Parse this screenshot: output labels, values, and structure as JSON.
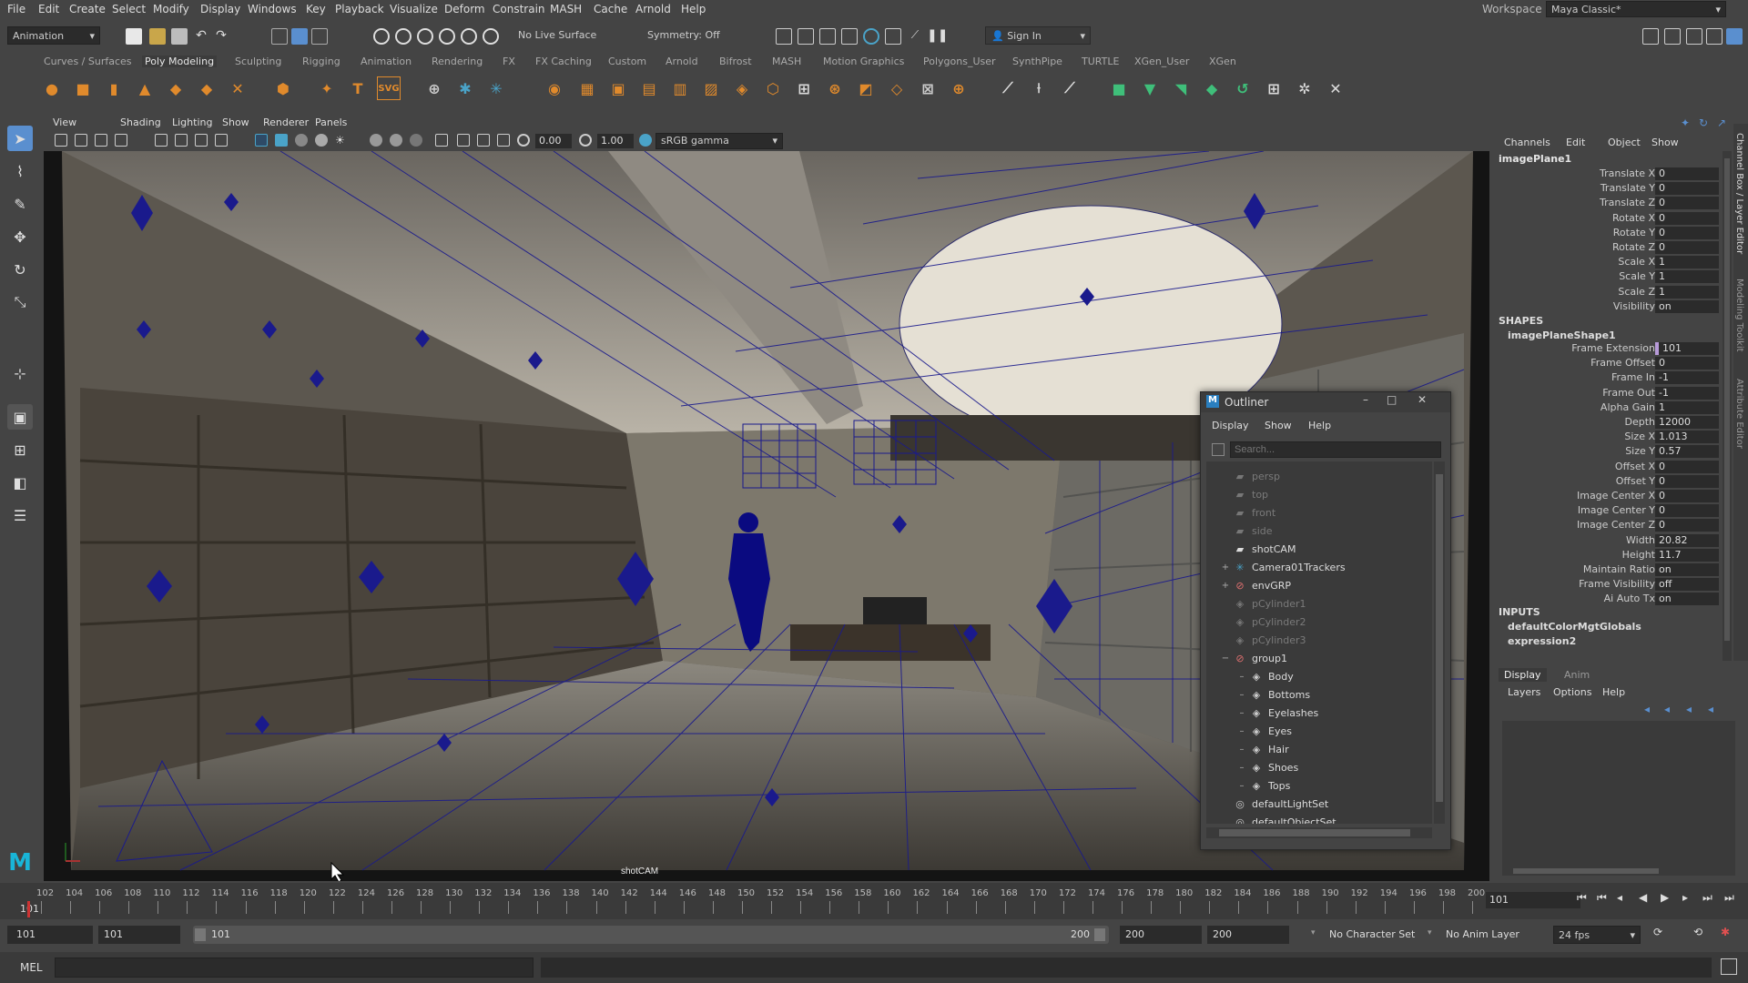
{
  "menubar": {
    "items": [
      "File",
      "Edit",
      "Create",
      "Select",
      "Modify",
      "Display",
      "Windows",
      "Key",
      "Playback",
      "Visualize",
      "Deform",
      "Constrain",
      "MASH",
      "Cache",
      "Arnold",
      "Help"
    ],
    "workspace_label": "Workspace :",
    "workspace_value": "Maya Classic*"
  },
  "statusline": {
    "mode": "Animation",
    "live_surface": "No Live Surface",
    "symmetry": "Symmetry: Off",
    "sign_in": "Sign In"
  },
  "shelf": {
    "tabs": [
      "Curves / Surfaces",
      "Poly Modeling",
      "Sculpting",
      "Rigging",
      "Animation",
      "Rendering",
      "FX",
      "FX Caching",
      "Custom",
      "Arnold",
      "Bifrost",
      "MASH",
      "Motion Graphics",
      "Polygons_User",
      "SynthPipe",
      "TURTLE",
      "XGen_User",
      "XGen"
    ],
    "active": "Poly Modeling",
    "svg_label": "SVG",
    "text_label": "T"
  },
  "viewport": {
    "menus": [
      "View",
      "Shading",
      "Lighting",
      "Show",
      "Renderer",
      "Panels"
    ],
    "exposure": "0.00",
    "gamma": "1.00",
    "color_space": "sRGB gamma",
    "camera_label": "shotCAM"
  },
  "outliner": {
    "title": "Outliner",
    "menus": [
      "Display",
      "Show",
      "Help"
    ],
    "search_placeholder": "Search...",
    "items": [
      {
        "label": "persp",
        "dim": true,
        "indent": 0,
        "icon": "camera-icon",
        "expand": ""
      },
      {
        "label": "top",
        "dim": true,
        "indent": 0,
        "icon": "camera-icon",
        "expand": ""
      },
      {
        "label": "front",
        "dim": true,
        "indent": 0,
        "icon": "camera-icon",
        "expand": ""
      },
      {
        "label": "side",
        "dim": true,
        "indent": 0,
        "icon": "camera-icon",
        "expand": ""
      },
      {
        "label": "shotCAM",
        "dim": false,
        "indent": 0,
        "icon": "camera-icon",
        "expand": ""
      },
      {
        "label": "Camera01Trackers",
        "dim": false,
        "indent": 0,
        "icon": "tracker-icon",
        "expand": "+"
      },
      {
        "label": "envGRP",
        "dim": false,
        "indent": 0,
        "icon": "group-icon",
        "expand": "+"
      },
      {
        "label": "pCylinder1",
        "dim": true,
        "indent": 0,
        "icon": "mesh-icon",
        "expand": ""
      },
      {
        "label": "pCylinder2",
        "dim": true,
        "indent": 0,
        "icon": "mesh-icon",
        "expand": ""
      },
      {
        "label": "pCylinder3",
        "dim": true,
        "indent": 0,
        "icon": "mesh-icon",
        "expand": ""
      },
      {
        "label": "group1",
        "dim": false,
        "indent": 0,
        "icon": "group-icon",
        "expand": "−"
      },
      {
        "label": "Body",
        "dim": false,
        "indent": 1,
        "icon": "mesh-icon",
        "expand": ""
      },
      {
        "label": "Bottoms",
        "dim": false,
        "indent": 1,
        "icon": "mesh-icon",
        "expand": ""
      },
      {
        "label": "Eyelashes",
        "dim": false,
        "indent": 1,
        "icon": "mesh-icon",
        "expand": ""
      },
      {
        "label": "Eyes",
        "dim": false,
        "indent": 1,
        "icon": "mesh-icon",
        "expand": ""
      },
      {
        "label": "Hair",
        "dim": false,
        "indent": 1,
        "icon": "mesh-icon",
        "expand": ""
      },
      {
        "label": "Shoes",
        "dim": false,
        "indent": 1,
        "icon": "mesh-icon",
        "expand": ""
      },
      {
        "label": "Tops",
        "dim": false,
        "indent": 1,
        "icon": "mesh-icon",
        "expand": ""
      },
      {
        "label": "defaultLightSet",
        "dim": false,
        "indent": 0,
        "icon": "set-icon",
        "expand": ""
      },
      {
        "label": "defaultObjectSet",
        "dim": false,
        "indent": 0,
        "icon": "set-icon",
        "expand": ""
      }
    ]
  },
  "channel_box": {
    "menus": [
      "Channels",
      "Edit",
      "Object",
      "Show"
    ],
    "node": "imagePlane1",
    "transform": [
      {
        "label": "Translate X",
        "value": "0"
      },
      {
        "label": "Translate Y",
        "value": "0"
      },
      {
        "label": "Translate Z",
        "value": "0"
      },
      {
        "label": "Rotate X",
        "value": "0"
      },
      {
        "label": "Rotate Y",
        "value": "0"
      },
      {
        "label": "Rotate Z",
        "value": "0"
      },
      {
        "label": "Scale X",
        "value": "1"
      },
      {
        "label": "Scale Y",
        "value": "1"
      },
      {
        "label": "Scale Z",
        "value": "1"
      },
      {
        "label": "Visibility",
        "value": "on"
      }
    ],
    "shapes_header": "SHAPES",
    "shape_node": "imagePlaneShape1",
    "shape_attrs": [
      {
        "label": "Frame Extension",
        "value": "101"
      },
      {
        "label": "Frame Offset",
        "value": "0"
      },
      {
        "label": "Frame In",
        "value": "-1"
      },
      {
        "label": "Frame Out",
        "value": "-1"
      },
      {
        "label": "Alpha Gain",
        "value": "1"
      },
      {
        "label": "Depth",
        "value": "12000"
      },
      {
        "label": "Size X",
        "value": "1.013"
      },
      {
        "label": "Size Y",
        "value": "0.57"
      },
      {
        "label": "Offset X",
        "value": "0"
      },
      {
        "label": "Offset Y",
        "value": "0"
      },
      {
        "label": "Image Center X",
        "value": "0"
      },
      {
        "label": "Image Center Y",
        "value": "0"
      },
      {
        "label": "Image Center Z",
        "value": "0"
      },
      {
        "label": "Width",
        "value": "20.82"
      },
      {
        "label": "Height",
        "value": "11.7"
      },
      {
        "label": "Maintain Ratio",
        "value": "on"
      },
      {
        "label": "Frame Visibility",
        "value": "off"
      },
      {
        "label": "Ai Auto Tx",
        "value": "on"
      }
    ],
    "inputs_header": "INPUTS",
    "inputs": [
      "defaultColorMgtGlobals",
      "expression2"
    ],
    "side_tabs": [
      "Channel Box / Layer Editor",
      "Modeling Toolkit",
      "Attribute Editor"
    ]
  },
  "layer_editor": {
    "tabs": [
      "Display",
      "Anim"
    ],
    "menus": [
      "Layers",
      "Options",
      "Help"
    ]
  },
  "timeline": {
    "ticks": [
      "102",
      "104",
      "106",
      "108",
      "110",
      "112",
      "114",
      "116",
      "118",
      "120",
      "122",
      "124",
      "126",
      "128",
      "130",
      "132",
      "134",
      "136",
      "138",
      "140",
      "142",
      "144",
      "146",
      "148",
      "150",
      "152",
      "154",
      "156",
      "158",
      "160",
      "162",
      "164",
      "166",
      "168",
      "170",
      "172",
      "174",
      "176",
      "178",
      "180",
      "182",
      "184",
      "186",
      "188",
      "190",
      "192",
      "194",
      "196",
      "198",
      "200"
    ],
    "start_marker": "101",
    "current": "101"
  },
  "range": {
    "start": "101",
    "inner_start": "101",
    "slider_start": "101",
    "slider_end": "200",
    "inner_end": "200",
    "end": "200",
    "char_set": "No Character Set",
    "anim_layer": "No Anim Layer",
    "fps": "24 fps"
  },
  "cmd": {
    "label": "MEL"
  },
  "colors": {
    "bg": "#444444",
    "field": "#2b2b2b",
    "wire": "#1a1a8c",
    "figure": "#0a0a80",
    "accent": "#5a8fcf"
  }
}
